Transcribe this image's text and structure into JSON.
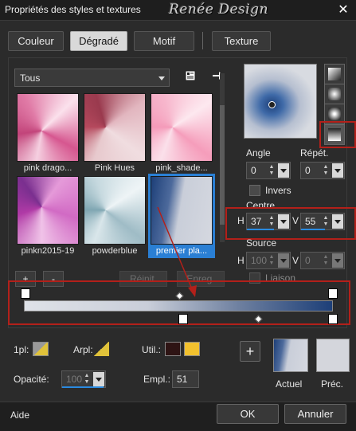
{
  "window": {
    "title": "Propriétés des styles et textures",
    "watermark": "Renée Design",
    "close": "✕"
  },
  "tabs": [
    {
      "label": "Couleur"
    },
    {
      "label": "Dégradé",
      "active": true
    },
    {
      "label": "Motif"
    },
    {
      "label": "Texture"
    }
  ],
  "library": {
    "filter": "Tous",
    "items": [
      {
        "label": "pink drago..."
      },
      {
        "label": "Pink Hues"
      },
      {
        "label": "pink_shade..."
      },
      {
        "label": "pinkn2015-19"
      },
      {
        "label": "powderblue"
      },
      {
        "label": "premier pla...",
        "selected": true
      }
    ],
    "add": "+",
    "remove": "-",
    "reset": "Réinit.",
    "save": "Enreg."
  },
  "settings": {
    "angle_label": "Angle",
    "angle": "0",
    "repeat_label": "Répét.",
    "repeat": "0",
    "invert_label": "Invers",
    "centre_label": "Centre",
    "h_label": "H",
    "centre_h": "37",
    "v_label": "V",
    "centre_v": "55",
    "source_label": "Source",
    "source_h": "100",
    "source_v": "0",
    "link_label": "Liaison"
  },
  "bottom": {
    "first_plane_label": "1pl:",
    "background_label": "Arpl:",
    "user_label": "Util.:",
    "opacity_label": "Opacité:",
    "opacity": "100",
    "location_label": "Empl.:",
    "location": "51",
    "add_button": "+",
    "current_label": "Actuel",
    "previous_label": "Préc."
  },
  "footer": {
    "help": "Aide",
    "ok": "OK",
    "cancel": "Annuler"
  },
  "colors": {
    "gradient_start": "#dfe2e8",
    "gradient_end": "#1d3f78",
    "user_color_1": "#2e1414",
    "user_color_2": "#f2c12e",
    "accent": "#2a8ae0",
    "highlight_red": "#b3201a"
  }
}
